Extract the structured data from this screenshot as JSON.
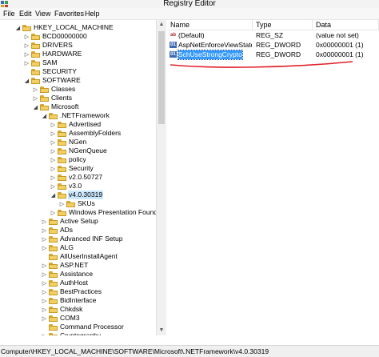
{
  "window": {
    "title": "Registry Editor"
  },
  "menu": [
    "File",
    "Edit",
    "View",
    "Favorites",
    "Help"
  ],
  "tree": [
    {
      "label": "HKEY_LOCAL_MACHINE",
      "level": 0,
      "expander": "◢"
    },
    {
      "label": "BCD00000000",
      "level": 1,
      "expander": "▷"
    },
    {
      "label": "DRIVERS",
      "level": 1,
      "expander": "▷"
    },
    {
      "label": "HARDWARE",
      "level": 1,
      "expander": "▷"
    },
    {
      "label": "SAM",
      "level": 1,
      "expander": "▷"
    },
    {
      "label": "SECURITY",
      "level": 1,
      "expander": ""
    },
    {
      "label": "SOFTWARE",
      "level": 1,
      "expander": "◢"
    },
    {
      "label": "Classes",
      "level": 2,
      "expander": "▷"
    },
    {
      "label": "Clients",
      "level": 2,
      "expander": "▷"
    },
    {
      "label": "Microsoft",
      "level": 2,
      "expander": "◢"
    },
    {
      "label": ".NETFramework",
      "level": 3,
      "expander": "◢"
    },
    {
      "label": "Advertised",
      "level": 4,
      "expander": "▷"
    },
    {
      "label": "AssemblyFolders",
      "level": 4,
      "expander": "▷"
    },
    {
      "label": "NGen",
      "level": 4,
      "expander": "▷"
    },
    {
      "label": "NGenQueue",
      "level": 4,
      "expander": "▷"
    },
    {
      "label": "policy",
      "level": 4,
      "expander": "▷"
    },
    {
      "label": "Security",
      "level": 4,
      "expander": "▷"
    },
    {
      "label": "v2.0.50727",
      "level": 4,
      "expander": "▷"
    },
    {
      "label": "v3.0",
      "level": 4,
      "expander": "▷"
    },
    {
      "label": "v4.0.30319",
      "level": 4,
      "expander": "◢",
      "selected": true
    },
    {
      "label": "SKUs",
      "level": 5,
      "expander": "▷"
    },
    {
      "label": "Windows Presentation Foundation",
      "level": 4,
      "expander": "▷"
    },
    {
      "label": "Active Setup",
      "level": 3,
      "expander": "▷"
    },
    {
      "label": "ADs",
      "level": 3,
      "expander": "▷"
    },
    {
      "label": "Advanced INF Setup",
      "level": 3,
      "expander": "▷"
    },
    {
      "label": "ALG",
      "level": 3,
      "expander": "▷"
    },
    {
      "label": "AllUserInstallAgent",
      "level": 3,
      "expander": ""
    },
    {
      "label": "ASP.NET",
      "level": 3,
      "expander": "▷"
    },
    {
      "label": "Assistance",
      "level": 3,
      "expander": "▷"
    },
    {
      "label": "AuthHost",
      "level": 3,
      "expander": "▷"
    },
    {
      "label": "BestPractices",
      "level": 3,
      "expander": "▷"
    },
    {
      "label": "BidInterface",
      "level": 3,
      "expander": "▷"
    },
    {
      "label": "Chkdsk",
      "level": 3,
      "expander": "▷"
    },
    {
      "label": "COM3",
      "level": 3,
      "expander": "▷"
    },
    {
      "label": "Command Processor",
      "level": 3,
      "expander": ""
    },
    {
      "label": "Cryptography",
      "level": 3,
      "expander": "▷"
    }
  ],
  "list": {
    "columns": [
      "Name",
      "Type",
      "Data"
    ],
    "rows": [
      {
        "icon": "string-value-icon",
        "glyph": "ab",
        "name": "(Default)",
        "type": "REG_SZ",
        "data": "(value not set)"
      },
      {
        "icon": "binary-value-icon",
        "glyph": "01",
        "name": "AspNetEnforceViewStateM...",
        "type": "REG_DWORD",
        "data": "0x00000001 (1)"
      },
      {
        "icon": "binary-value-icon",
        "glyph": "01",
        "name": "SchUseStrongCrypto",
        "type": "REG_DWORD",
        "data": "0x00000001 (1)",
        "selected": true
      }
    ]
  },
  "annotation": {
    "color": "#e0202a"
  },
  "status": {
    "path": "Computer\\HKEY_LOCAL_MACHINE\\SOFTWARE\\Microsoft\\.NETFramework\\v4.0.30319"
  }
}
